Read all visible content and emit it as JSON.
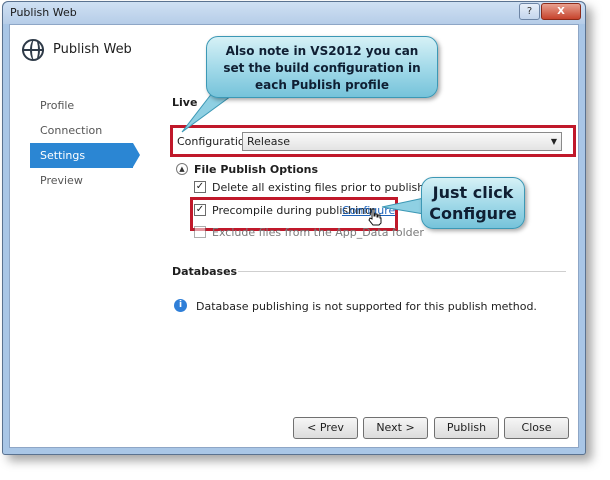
{
  "window": {
    "title": "Publish Web",
    "help_label": "?",
    "close_label": "X"
  },
  "header": {
    "title": "Publish Web",
    "icon": "globe-icon"
  },
  "nav": {
    "items": [
      {
        "label": "Profile"
      },
      {
        "label": "Connection"
      },
      {
        "label": "Settings"
      },
      {
        "label": "Preview"
      }
    ],
    "active": "Settings"
  },
  "settings": {
    "section_title": "Live",
    "configuration_label": "Configuration:",
    "configuration_value": "Release",
    "file_publish_options_title": "File Publish Options",
    "options": [
      {
        "label": "Delete all existing files prior to publish",
        "checked": true
      },
      {
        "label": "Precompile during publishing",
        "checked": true,
        "link": "Configure"
      },
      {
        "label": "Exclude files from the App_Data folder",
        "checked": false
      }
    ],
    "databases_title": "Databases",
    "databases_message": "Database publishing is not supported for this publish method."
  },
  "buttons": {
    "prev": "< Prev",
    "next": "Next >",
    "publish": "Publish",
    "close": "Close"
  },
  "callouts": {
    "top_line1": "Also note in VS2012 you can",
    "top_line2": "set the build configuration in",
    "top_line3": "each Publish profile",
    "right_line1": "Just click",
    "right_line2": "Configure"
  },
  "colors": {
    "accent": "#2b86d3",
    "highlight_border": "#c0182a",
    "link": "#1c62b9",
    "callout": "#9fd8e8"
  }
}
